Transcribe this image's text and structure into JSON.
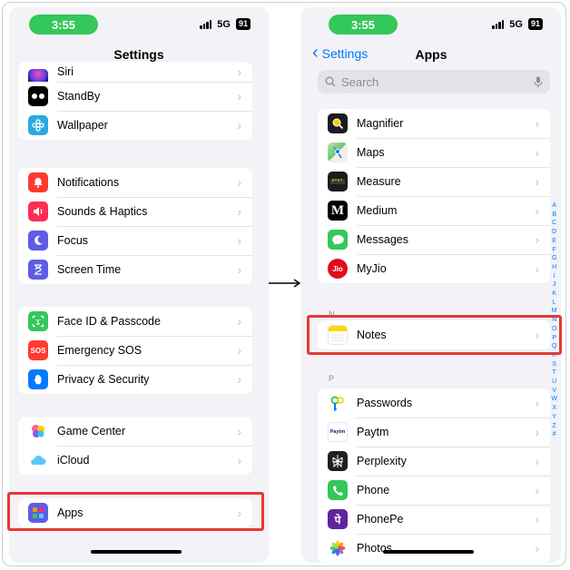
{
  "status": {
    "time": "3:55",
    "network": "5G",
    "battery": "91"
  },
  "left_screen": {
    "title": "Settings",
    "groups": [
      [
        {
          "label": "Siri",
          "icon": "siri-icon"
        },
        {
          "label": "StandBy",
          "icon": "standby-icon"
        },
        {
          "label": "Wallpaper",
          "icon": "wallpaper-icon"
        }
      ],
      [
        {
          "label": "Notifications",
          "icon": "notifications-icon"
        },
        {
          "label": "Sounds & Haptics",
          "icon": "sounds-icon"
        },
        {
          "label": "Focus",
          "icon": "focus-icon"
        },
        {
          "label": "Screen Time",
          "icon": "screen-time-icon"
        }
      ],
      [
        {
          "label": "Face ID & Passcode",
          "icon": "face-id-icon"
        },
        {
          "label": "Emergency SOS",
          "icon": "sos-icon"
        },
        {
          "label": "Privacy & Security",
          "icon": "privacy-icon"
        }
      ],
      [
        {
          "label": "Game Center",
          "icon": "game-center-icon"
        },
        {
          "label": "iCloud",
          "icon": "icloud-icon"
        }
      ],
      [
        {
          "label": "Apps",
          "icon": "apps-icon"
        }
      ]
    ]
  },
  "right_screen": {
    "back_label": "Settings",
    "title": "Apps",
    "search_placeholder": "Search",
    "group_m": [
      {
        "label": "Magnifier"
      },
      {
        "label": "Maps"
      },
      {
        "label": "Measure"
      },
      {
        "label": "Medium"
      },
      {
        "label": "Messages"
      },
      {
        "label": "MyJio"
      }
    ],
    "section_n": "N",
    "group_n": [
      {
        "label": "Notes"
      }
    ],
    "section_p": "P",
    "group_p": [
      {
        "label": "Passwords"
      },
      {
        "label": "Paytm"
      },
      {
        "label": "Perplexity"
      },
      {
        "label": "Phone"
      },
      {
        "label": "PhonePe"
      },
      {
        "label": "Photos"
      }
    ],
    "index": [
      "A",
      "B",
      "C",
      "D",
      "E",
      "F",
      "G",
      "H",
      "I",
      "J",
      "K",
      "L",
      "M",
      "N",
      "O",
      "P",
      "Q",
      "R",
      "S",
      "T",
      "U",
      "V",
      "W",
      "X",
      "Y",
      "Z",
      "#"
    ]
  },
  "icon_text": {
    "sos": "SOS",
    "medium": "M",
    "jio": "Jio",
    "paytm": "Paytm",
    "phonepe": "पे"
  },
  "colors": {
    "highlight": "#e53935",
    "accent": "#007aff",
    "status_pill": "#34c759"
  }
}
